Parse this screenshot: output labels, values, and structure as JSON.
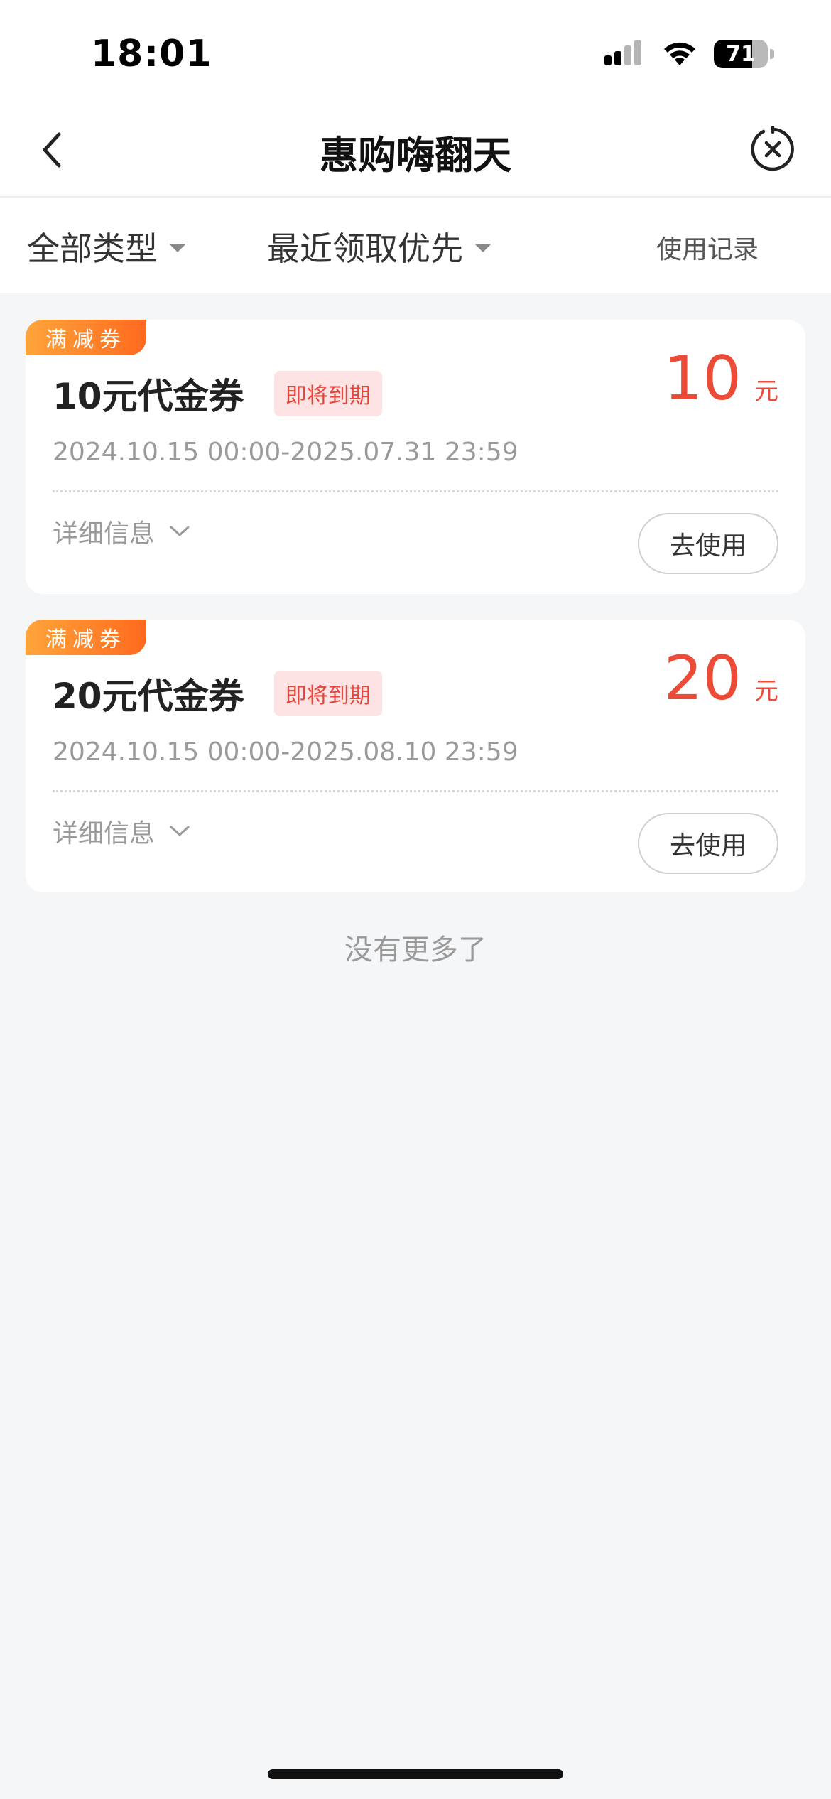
{
  "status_bar": {
    "time": "18:01",
    "battery_level": "71",
    "battery_fraction": 0.71,
    "icons": [
      "signal-icon",
      "wifi-icon",
      "battery-icon"
    ]
  },
  "nav": {
    "title": "惠购嗨翻天",
    "back_icon": "chevron-left-icon",
    "close_icon": "close-circle-icon"
  },
  "filters": {
    "type_label": "全部类型",
    "sort_label": "最近领取优先",
    "usage_record": "使用记录"
  },
  "coupons": [
    {
      "tag": "满减券",
      "title": "10元代金券",
      "badge": "即将到期",
      "amount": "10",
      "unit": "元",
      "date_range": "2024.10.15 00:00-2025.07.31 23:59",
      "detail_label": "详细信息",
      "action_label": "去使用"
    },
    {
      "tag": "满减券",
      "title": "20元代金券",
      "badge": "即将到期",
      "amount": "20",
      "unit": "元",
      "date_range": "2024.10.15 00:00-2025.08.10 23:59",
      "detail_label": "详细信息",
      "action_label": "去使用"
    }
  ],
  "footer": {
    "no_more": "没有更多了"
  },
  "colors": {
    "accent_red": "#ec4b37",
    "tag_orange": "#ff6a1f",
    "badge_bg": "#fde3e3",
    "page_bg": "#f5f6f8"
  }
}
